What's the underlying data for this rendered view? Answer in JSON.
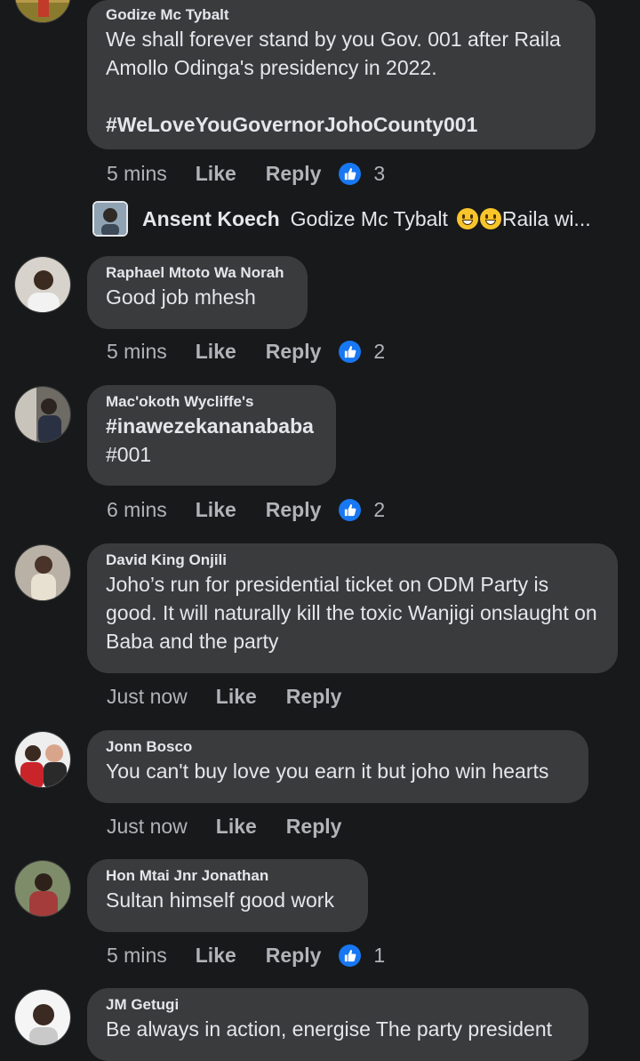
{
  "comments": [
    {
      "author": "Godize Mc Tybalt",
      "text": "We shall forever stand by you Gov. 001 after Raila Amollo Odinga's presidency in 2022.",
      "hashtag": "#WeLoveYouGovernorJohoCounty001",
      "time": "5 mins",
      "like": "Like",
      "reply": "Reply",
      "reactions": "3"
    },
    {
      "author": "Raphael Mtoto Wa Norah",
      "text": "Good job mhesh",
      "time": "5 mins",
      "like": "Like",
      "reply": "Reply",
      "reactions": "2"
    },
    {
      "author": "Mac'okoth Wycliffe's",
      "text_bold": "#inawezekananababa",
      "text": "#001",
      "time": "6 mins",
      "like": "Like",
      "reply": "Reply",
      "reactions": "2"
    },
    {
      "author": "David King Onjili",
      "text": "Joho’s run for presidential ticket on ODM Party is good. It will naturally kill the toxic Wanjigi onslaught on Baba and the party",
      "time": "Just now",
      "like": "Like",
      "reply": "Reply"
    },
    {
      "author": "Jonn Bosco",
      "text": "You can't buy love you earn it but joho win hearts",
      "time": "Just now",
      "like": "Like",
      "reply": "Reply"
    },
    {
      "author": "Hon Mtai Jnr Jonathan",
      "text": "Sultan himself good work",
      "time": "5 mins",
      "like": "Like",
      "reply": "Reply",
      "reactions": "1"
    },
    {
      "author": "JM Getugi",
      "text": "Be always in action, energise The party president"
    }
  ],
  "reply_preview": {
    "author": "Ansent Koech",
    "text_before": "Godize Mc Tybalt",
    "text_after": "Raila wi..."
  },
  "colors": {
    "background": "#18191a",
    "bubble": "#3a3b3c",
    "text": "#e4e6eb",
    "secondary": "#b0b3b8",
    "like_blue": "#1877f2"
  },
  "icons": [
    "avatar",
    "thumbs-up-icon",
    "grinning-emoji-icon"
  ]
}
